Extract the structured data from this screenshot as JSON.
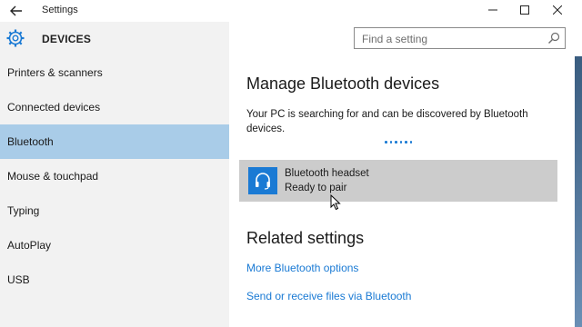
{
  "window": {
    "title": "Settings",
    "minimize_glyph": "—",
    "maximize_glyph": "☐",
    "close_glyph": "✕"
  },
  "header": {
    "section_title": "DEVICES",
    "icon": "gear-icon"
  },
  "search": {
    "placeholder": "Find a setting",
    "icon": "search-icon"
  },
  "sidebar": {
    "items": [
      {
        "label": "Printers & scanners",
        "active": false
      },
      {
        "label": "Connected devices",
        "active": false
      },
      {
        "label": "Bluetooth",
        "active": true
      },
      {
        "label": "Mouse & touchpad",
        "active": false
      },
      {
        "label": "Typing",
        "active": false
      },
      {
        "label": "AutoPlay",
        "active": false
      },
      {
        "label": "USB",
        "active": false
      }
    ]
  },
  "main": {
    "title": "Manage Bluetooth devices",
    "description": "Your PC is searching for and can be discovered by Bluetooth devices.",
    "device": {
      "name": "Bluetooth headset",
      "status": "Ready to pair",
      "icon": "headset-icon"
    },
    "related_title": "Related settings",
    "links": [
      "More Bluetooth options",
      "Send or receive files via Bluetooth"
    ]
  },
  "colors": {
    "accent": "#1a7ad4",
    "sidebar_bg": "#f2f2f2",
    "active_item_bg": "#a9cce8",
    "device_bg": "#cccccc"
  }
}
